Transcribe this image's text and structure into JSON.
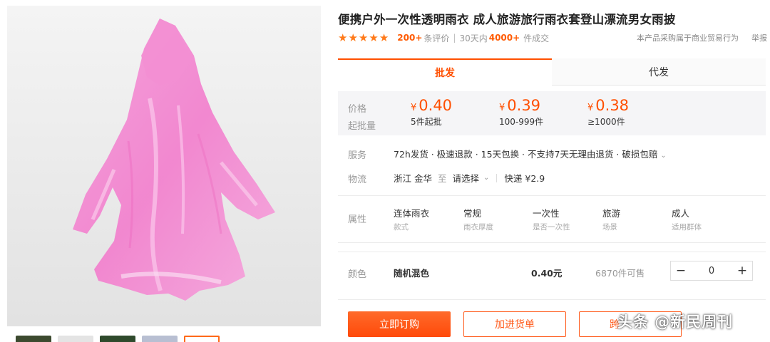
{
  "product": {
    "title": "便携户外一次性透明雨衣 成人旅游旅行雨衣套登山漂流男女雨披",
    "rating": {
      "stars": 5,
      "review_count": "200+",
      "review_suffix": "条评价",
      "period_prefix": "30天内",
      "sold_count": "4000+",
      "sold_suffix": "件成交",
      "trade_note": "本产品采购属于商业贸易行为",
      "report_link": "举报"
    }
  },
  "tabs": [
    {
      "label": "批发",
      "active": true
    },
    {
      "label": "代发",
      "active": false
    }
  ],
  "price_box": {
    "price_label": "价格",
    "moq_label": "起批量",
    "currency": "¥",
    "tiers": [
      {
        "price": "0.40",
        "qty": "5件起批"
      },
      {
        "price": "0.39",
        "qty": "100-999件"
      },
      {
        "price": "0.38",
        "qty": "≥1000件"
      }
    ]
  },
  "service": {
    "label": "服务",
    "text": "72h发货 · 极速退款 · 15天包换 · 不支持7天无理由退货 · 破损包赔"
  },
  "logistics": {
    "label": "物流",
    "origin": "浙江 金华",
    "to": "至",
    "destination": "请选择",
    "shipping": "快递 ¥2.9"
  },
  "attributes": {
    "label": "属性",
    "items": [
      {
        "value": "连体雨衣",
        "key": "款式"
      },
      {
        "value": "常规",
        "key": "雨衣厚度"
      },
      {
        "value": "一次性",
        "key": "是否一次性"
      },
      {
        "value": "旅游",
        "key": "场景"
      },
      {
        "value": "成人",
        "key": "适用群体"
      }
    ]
  },
  "color_row": {
    "label": "颜色",
    "option": "随机混色",
    "price": "0.40元",
    "stock": "6870件可售",
    "quantity": "0",
    "minus": "−",
    "plus": "+"
  },
  "actions": {
    "buy_now": "立即订购",
    "add_cart": "加进货单",
    "third": "跨"
  },
  "watermark": "头条 @新民周刊",
  "colors": {
    "accent": "#ff4f00",
    "raincoat": "#f06cc4"
  }
}
